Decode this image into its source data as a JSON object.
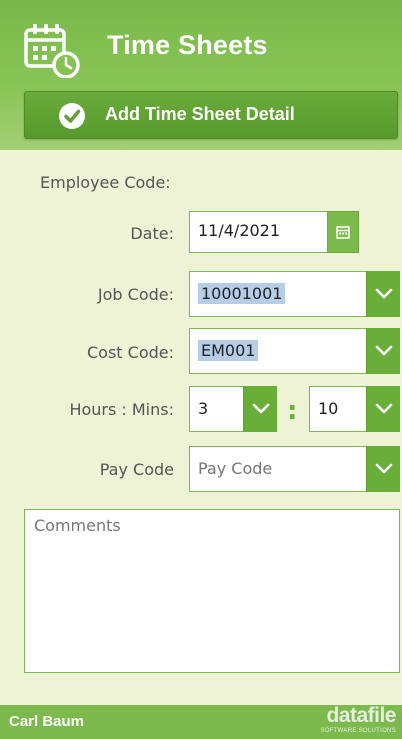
{
  "header": {
    "title": "Time Sheets",
    "icon": "calendar-clock-icon"
  },
  "add_button": {
    "label": "Add Time Sheet Detail",
    "icon": "check-circle-icon"
  },
  "form": {
    "employee_code": {
      "label": "Employee Code:"
    },
    "date": {
      "label": "Date:",
      "value": "11/4/2021",
      "icon": "calendar-icon"
    },
    "job_code": {
      "label": "Job Code:",
      "value": "10001001"
    },
    "cost_code": {
      "label": "Cost Code:",
      "value": "EM001"
    },
    "hours_mins": {
      "label": "Hours : Mins:",
      "hours": "3",
      "separator": ":",
      "mins": "10"
    },
    "pay_code": {
      "label": "Pay Code",
      "placeholder": "Pay Code"
    },
    "comments": {
      "placeholder": "Comments"
    }
  },
  "footer": {
    "user": "Carl Baum",
    "brand": "datafile",
    "brand_tagline": "SOFTWARE SOLUTIONS"
  },
  "colors": {
    "primary": "#7dba4d",
    "dark": "#5f9f33",
    "background": "#eef3d5",
    "selection": "#b6cde8"
  }
}
